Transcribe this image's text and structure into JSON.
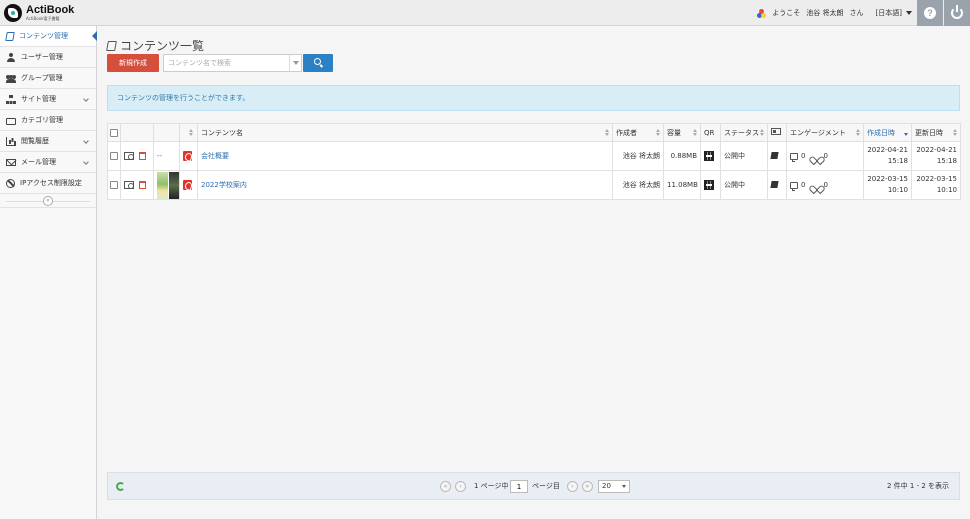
{
  "app": {
    "logo_text": "ActiBook",
    "logo_sub": "ActiBook電子書籍"
  },
  "header": {
    "welcome": "ようこそ",
    "user_name": "池谷 将太朗",
    "honorific": "さん",
    "language": "[日本語]"
  },
  "sidebar": {
    "items": [
      {
        "label": "コンテンツ管理",
        "icon": "book-icon"
      },
      {
        "label": "ユーザー管理",
        "icon": "user-icon"
      },
      {
        "label": "グループ管理",
        "icon": "group-icon"
      },
      {
        "label": "サイト管理",
        "icon": "sitemap-icon"
      },
      {
        "label": "カテゴリ管理",
        "icon": "folder-icon"
      },
      {
        "label": "閲覧履歴",
        "icon": "bar-chart-icon"
      },
      {
        "label": "メール管理",
        "icon": "mail-icon"
      },
      {
        "label": "IPアクセス制限設定",
        "icon": "ban-icon"
      }
    ],
    "collapse": "«"
  },
  "page": {
    "title": "コンテンツ一覧",
    "new_button": "新規作成",
    "search_placeholder": "コンテンツ名で検索",
    "info": "コンテンツの管理を行うことができます。"
  },
  "table": {
    "headers": {
      "name": "コンテンツ名",
      "author": "作成者",
      "size": "容量",
      "qr": "QR",
      "status": "ステータス",
      "engagement": "エンゲージメント",
      "created": "作成日時",
      "updated": "更新日時"
    },
    "rows": [
      {
        "thumb": "--",
        "name": "会社概要",
        "author": "池谷 将太朗",
        "size": "0.88MB",
        "status": "公開中",
        "comments": "0",
        "likes": "0",
        "created_date": "2022-04-21",
        "created_time": "15:18",
        "updated_date": "2022-04-21",
        "updated_time": "15:18"
      },
      {
        "thumb": "",
        "name": "2022学校案内",
        "author": "池谷 将太朗",
        "size": "11.08MB",
        "status": "公開中",
        "comments": "0",
        "likes": "0",
        "created_date": "2022-03-15",
        "created_time": "10:10",
        "updated_date": "2022-03-15",
        "updated_time": "10:10"
      }
    ]
  },
  "pager": {
    "first": "«",
    "prev": "‹",
    "page_prefix": "1 ページ中",
    "page_value": "1",
    "page_suffix": "ページ目",
    "next": "›",
    "last": "»",
    "per_page": "20",
    "summary": "2 件中 1 - 2 を表示"
  },
  "colors": {
    "accent": "#2a6db0",
    "new_button": "#d64f3c",
    "search_button": "#2c80c4",
    "info_bg": "#d9edf7"
  }
}
